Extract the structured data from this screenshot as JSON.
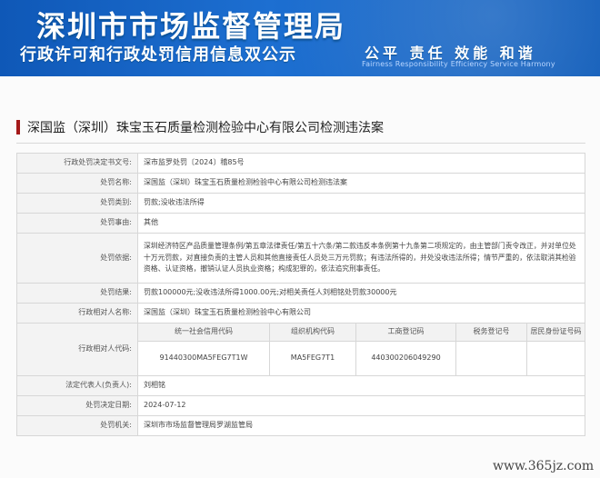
{
  "header": {
    "title": "深圳市市场监督管理局",
    "subtitle": "行政许可和行政处罚信用信息双公示",
    "motto": "公平 责任 效能 和谐",
    "motto_en": "Fairness Responsibility Efficiency Service Harmony",
    "brand_color": "#1465c7"
  },
  "page": {
    "title": "深国监（深圳）珠宝玉石质量检测检验中心有限公司检测违法案"
  },
  "rows": {
    "decision_no_label": "行政处罚决定书文号:",
    "decision_no": "深市监罗处罚〔2024〕稽85号",
    "name_label": "处罚名称:",
    "name": "深国监（深圳）珠宝玉石质量检测检验中心有限公司检测违法案",
    "type_label": "处罚类别:",
    "type": "罚款;没收违法所得",
    "reason_label": "处罚事由:",
    "reason": "其他",
    "basis_label": "处罚依据:",
    "basis": "深圳经济特区产品质量管理条例/第五章法律责任/第五十六条/第二款违反本条例第十九条第二项规定的，由主管部门责令改正，并对单位处十万元罚款，对直接负责的主管人员和其他直接责任人员处三万元罚款；有违法所得的，并处没收违法所得；情节严重的，依法取消其检验资格、认证资格，撤销认证人员执业资格；构成犯罪的，依法追究刑事责任。",
    "result_label": "处罚结果:",
    "result": "罚款100000元;没收违法所得1000.00元;对相关责任人刘相铭处罚款30000元",
    "party_label": "行政相对人名称:",
    "party": "深国监（深圳）珠宝玉石质量检测检验中心有限公司",
    "party_code_label": "行政相对人代码:",
    "codes": {
      "h1": "统一社会信用代码",
      "h2": "组织机构代码",
      "h3": "工商登记码",
      "h4": "税务登记号",
      "h5": "居民身份证号码",
      "v1": "91440300MA5FEG7T1W",
      "v2": "MA5FEG7T1",
      "v3": "440300206049290",
      "v4": "",
      "v5": ""
    },
    "legal_label": "法定代表人(负责人):",
    "legal": "刘相铭",
    "date_label": "处罚决定日期:",
    "date": "2024-07-12",
    "agency_label": "处罚机关:",
    "agency": "深圳市市场监督管理局罗湖监管局"
  },
  "watermark": "www.365jz.com"
}
